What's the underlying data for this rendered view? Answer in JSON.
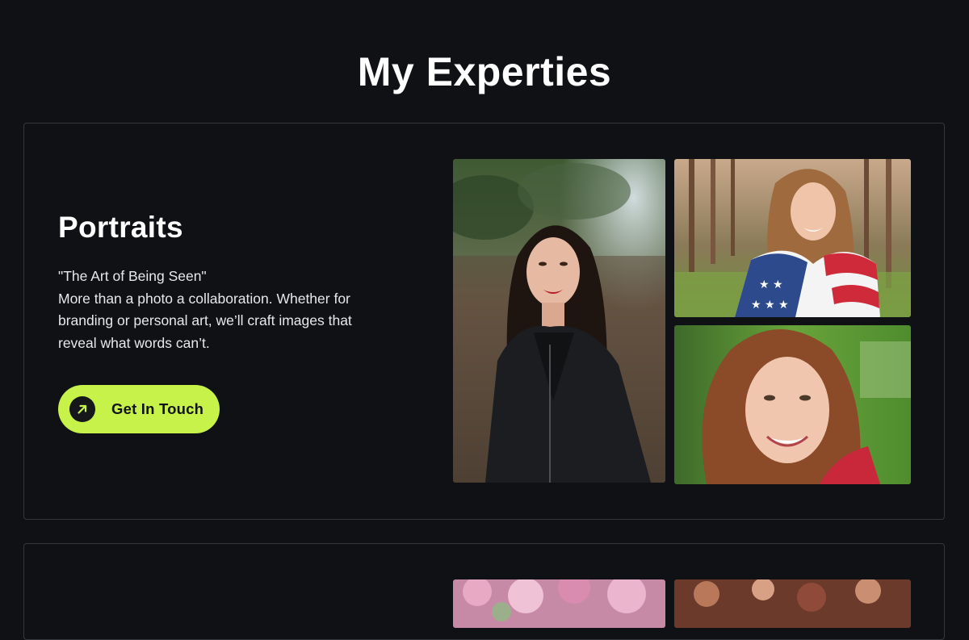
{
  "section": {
    "title": "My Experties"
  },
  "cards": [
    {
      "title": "Portraits",
      "tagline": "\"The Art of Being Seen\"",
      "description_lines": [
        "More than a photo a collaboration. Whether for",
        "branding or personal art, we’ll craft images that",
        "reveal what words can’t."
      ],
      "button_label": "Get In Touch",
      "button_icon": "arrow-up-right-icon",
      "photos": [
        "portrait-woman-leather-jacket-photo",
        "portrait-woman-flag-photo",
        "portrait-woman-smiling-photo"
      ]
    },
    {
      "photos": [
        "pink-blossom-photo",
        "autumn-flowers-photo"
      ]
    }
  ],
  "colors": {
    "background": "#0f1114",
    "card_border": "#34373c",
    "accent": "#c6f24a",
    "text": "#ffffff"
  }
}
